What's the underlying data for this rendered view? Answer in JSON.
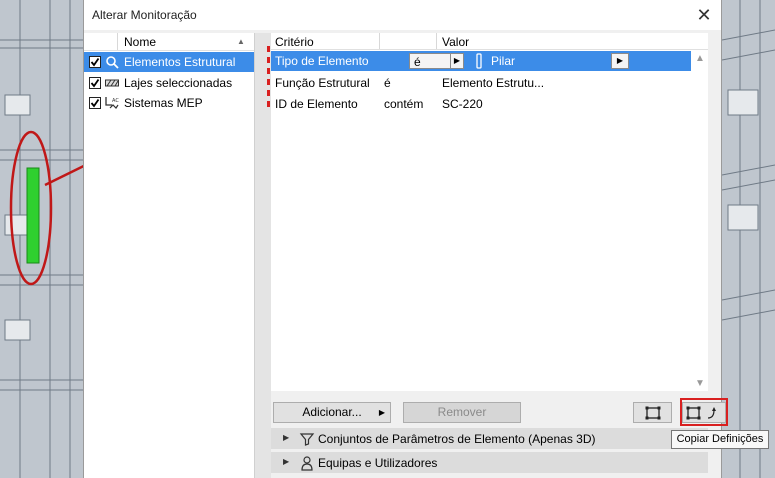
{
  "dialog": {
    "title": "Alterar Monitoração",
    "close_glyph": "✕"
  },
  "left_list": {
    "header": "Nome",
    "sort_glyph": "▲",
    "items": [
      {
        "label": "Elementos Estrutural",
        "checked": true,
        "selected": true,
        "icon": "search-icon"
      },
      {
        "label": "Lajes seleccionadas",
        "checked": true,
        "selected": false,
        "icon": "slab-icon"
      },
      {
        "label": "Sistemas MEP",
        "checked": true,
        "selected": false,
        "icon": "mep-icon"
      }
    ]
  },
  "criteria_table": {
    "headers": {
      "criterion": "Critério",
      "value": "Valor"
    },
    "rows": [
      {
        "criterion": "Tipo de Elemento",
        "operator": "é",
        "value": "Pilar",
        "selected": true,
        "value_icon": "column-icon"
      },
      {
        "criterion": "Função Estrutural",
        "operator": "é",
        "value": "Elemento Estrutu...",
        "selected": false
      },
      {
        "criterion": "ID de Elemento",
        "operator": "contém",
        "value": "SC-220",
        "selected": false
      }
    ]
  },
  "buttons": {
    "add": "Adicionar...",
    "remove": "Remover"
  },
  "sections": [
    {
      "label": "Conjuntos de Parâmetros de Elemento (Apenas 3D)",
      "icon": "filter-icon"
    },
    {
      "label": "Equipas e Utilizadores",
      "icon": "users-icon"
    }
  ],
  "tooltip": "Copiar Definições",
  "colors": {
    "selection": "#3c8ce8",
    "highlight_red": "#d92020",
    "element_green": "#2fd02f"
  }
}
